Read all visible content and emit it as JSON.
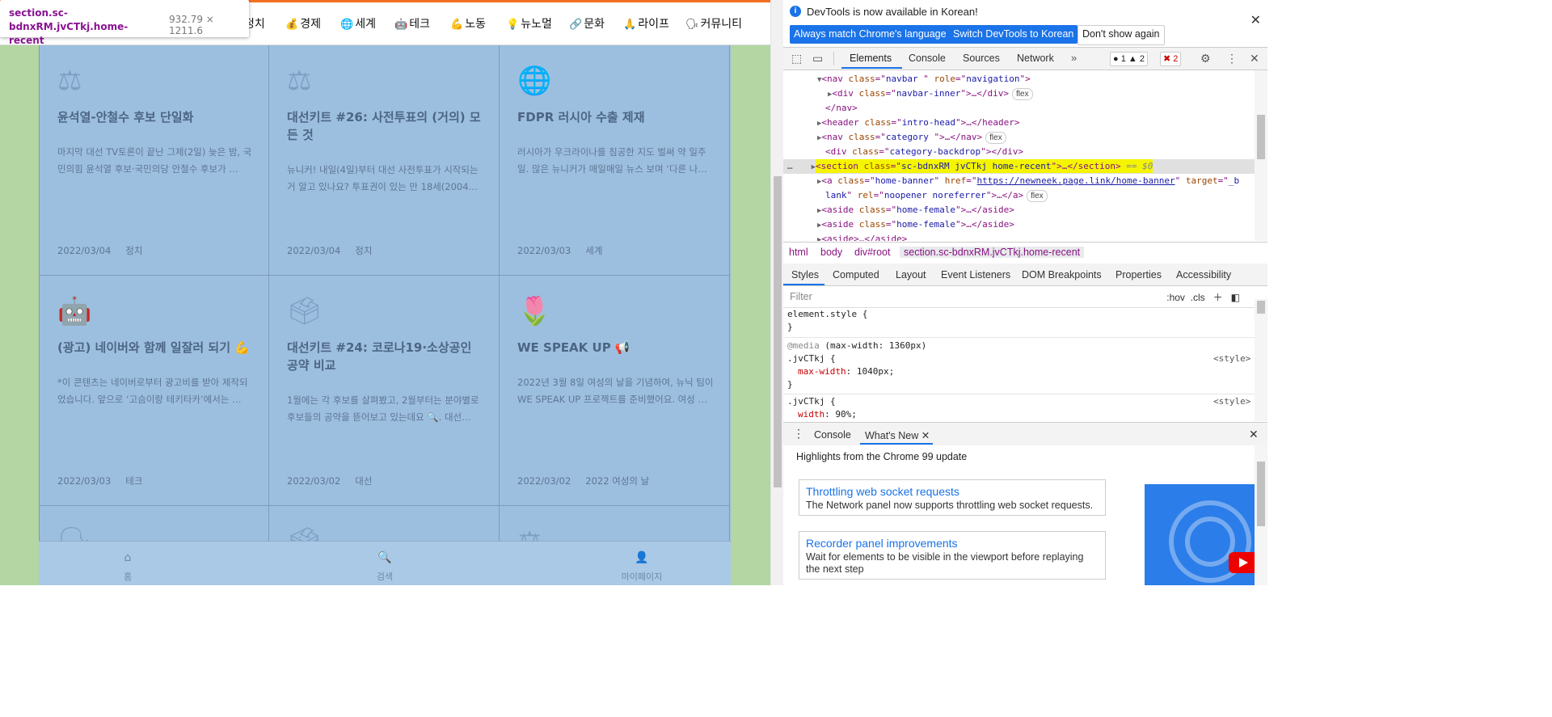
{
  "tooltip": {
    "selector": "section.sc-bdnxRM.jvCTkj.home-recent",
    "dimensions": "932.79 × 1211.6"
  },
  "nav": {
    "items": [
      {
        "icon": "",
        "label": "정치"
      },
      {
        "icon": "💰",
        "label": "경제"
      },
      {
        "icon": "🌐",
        "label": "세계"
      },
      {
        "icon": "🤖",
        "label": "테크"
      },
      {
        "icon": "💪",
        "label": "노동"
      },
      {
        "icon": "💡",
        "label": "뉴노멀"
      },
      {
        "icon": "🔗",
        "label": "문화"
      },
      {
        "icon": "🙏",
        "label": "라이프"
      },
      {
        "icon": "🗣",
        "label": "커뮤니티"
      }
    ]
  },
  "cards": [
    {
      "icon": "scales-icon",
      "glyph": "⚖",
      "title": "윤석열-안철수 후보 단일화",
      "desc": "마지막 대선 TV토론이 끝난 그제(2일) 늦은 밤, 국민의힘 윤석열 후보·국민의당 안철수 후보가 …",
      "date": "2022/03/04",
      "category": "정치"
    },
    {
      "icon": "scales-icon",
      "glyph": "⚖",
      "title": "대선키트 #26: 사전투표의 (거의) 모든 것",
      "desc": "뉴니커! 내일(4일)부터 대선 사전투표가 시작되는 거 알고 있나요? 투표권이 있는 만 18세(2004…",
      "date": "2022/03/04",
      "category": "정치"
    },
    {
      "icon": "globe-icon",
      "glyph": "🌐",
      "title": "FDPR 러시아 수출 제재",
      "desc": "러시아가 우크라이나를 침공한 지도 벌써 약 일주일. 많은 뉴니커가 매일매일 뉴스 보며 ‘다른 나…",
      "date": "2022/03/03",
      "category": "세계"
    },
    {
      "icon": "robot-icon",
      "glyph": "🤖",
      "title": "(광고) 네이버와 함께 일잘러 되기 💪",
      "desc": "*이 콘텐츠는 네이버로부터 광고비를 받아 제작되었습니다. 앞으로 ‘고슴이랑 테키타카’에서는 …",
      "date": "2022/03/03",
      "category": "테크"
    },
    {
      "icon": "ballot-box-icon",
      "glyph": "🗳",
      "title": "대선키트 #24: 코로나19·소상공인 공약 비교",
      "desc": "1월에는 각 후보를 살펴봤고, 2월부터는 분야별로 후보들의 공약을 뜯어보고 있는데요 🔍. 대선…",
      "date": "2022/03/02",
      "category": "대선"
    },
    {
      "icon": "tulip-icon",
      "glyph": "🌷",
      "title": "WE SPEAK UP 📢",
      "desc": "2022년 3월 8일 여성의 날을 기념하여, 뉴닉 팀이 WE SPEAK UP 프로젝트를 준비했어요. 여성 …",
      "date": "2022/03/02",
      "category": "2022 여성의 날"
    }
  ],
  "bottom_nav": {
    "home": "홈",
    "search": "검색",
    "mypage": "마이페이지"
  },
  "devtools": {
    "notice": {
      "message": "DevTools is now available in Korean!",
      "btn_match": "Always match Chrome's language",
      "btn_switch": "Switch DevTools to Korean",
      "btn_dismiss": "Don't show again"
    },
    "tabs": [
      "Elements",
      "Console",
      "Sources",
      "Network"
    ],
    "badges": {
      "info": "1",
      "warn": "2",
      "err": "2"
    },
    "dom": {
      "l1": {
        "tag": "nav",
        "a1": "class",
        "v1": "navbar ",
        "a2": "role",
        "v2": "navigation"
      },
      "l2": {
        "tag": "div",
        "a1": "class",
        "v1": "navbar-inner",
        "tail": "…</div>",
        "pill": "flex"
      },
      "l3": "</nav>",
      "l4": {
        "tag": "header",
        "a1": "class",
        "v1": "intro-head",
        "tail": "…</header>"
      },
      "l5": {
        "tag": "nav",
        "a1": "class",
        "v1": "category ",
        "tail": "…</nav>",
        "pill": "flex"
      },
      "l6": {
        "tag": "div",
        "a1": "class",
        "v1": "category-backdrop",
        "tail": "</div>"
      },
      "l7": {
        "tag": "section",
        "a1": "class",
        "v1": "sc-bdnxRM jvCTkj home-recent",
        "tail": "…</section>",
        "eq": "== $0"
      },
      "l8": {
        "tag": "a",
        "a1": "class",
        "v1": "home-banner",
        "a2": "href",
        "v2": "https://newneek.page.link/home-banner",
        "a3": "target",
        "v3a": "_b",
        "v3b": "lank",
        "a4": "rel",
        "v4": "noopener noreferrer",
        "tail": "…</a>",
        "pill": "flex"
      },
      "l9": {
        "tag": "aside",
        "a1": "class",
        "v1": "home-female",
        "tail": "…</aside>"
      },
      "l10": {
        "tag": "aside",
        "a1": "class",
        "v1": "home-female",
        "tail": "…</aside>"
      },
      "l11": {
        "tag": "aside",
        "tail": "…</aside>"
      }
    },
    "breadcrumbs": [
      "html",
      "body",
      "div#root",
      "section.sc-bdnxRM.jvCTkj.home-recent"
    ],
    "styles_tabs": [
      "Styles",
      "Computed",
      "Layout",
      "Event Listeners",
      "DOM Breakpoints",
      "Properties",
      "Accessibility"
    ],
    "filter_placeholder": "Filter",
    "filter_hov": ":hov",
    "filter_cls": ".cls",
    "rules": {
      "r1_sel": "element.style {",
      "r1_end": "}",
      "media": "@media",
      "media_q": "(max-width: 1360px)",
      "r2_sel": ".jvCTkj {",
      "r2_prop": "max-width",
      "r2_val": "1040px;",
      "r2_end": "}",
      "r3_sel": ".jvCTkj {",
      "r3_prop": "width",
      "r3_val": "90%;",
      "source": "<style>"
    },
    "drawer_tabs": {
      "console": "Console",
      "whatsnew": "What's New"
    },
    "whatsnew": {
      "heading": "Highlights from the Chrome 99 update",
      "items": [
        {
          "title": "Throttling web socket requests",
          "desc": "The Network panel now supports throttling web socket requests."
        },
        {
          "title": "Recorder panel improvements",
          "desc": "Wait for elements to be visible in the viewport before replaying the next step"
        }
      ]
    }
  }
}
